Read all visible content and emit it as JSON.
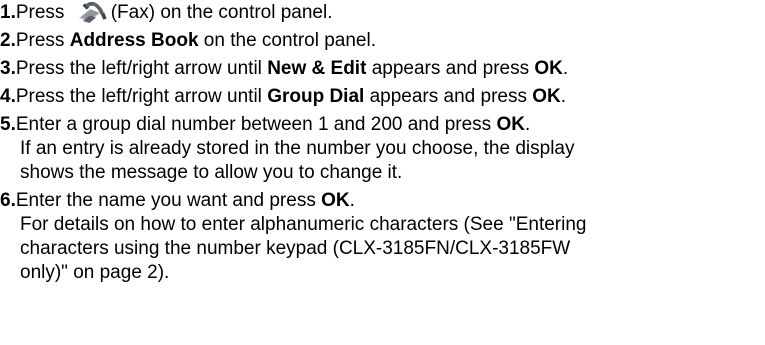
{
  "steps": [
    {
      "num": "1.",
      "pre": "Press ",
      "icon": "fax-icon",
      "post": "(Fax) on the control panel."
    },
    {
      "num": "2.",
      "pre": "Press ",
      "bold1": "Address Book",
      "post": " on the control panel."
    },
    {
      "num": "3.",
      "pre": "Press the left/right arrow until ",
      "bold1": "New & Edit",
      "mid": " appears and press ",
      "bold2": "OK",
      "post": "."
    },
    {
      "num": "4.",
      "pre": "Press the left/right arrow until ",
      "bold1": "Group Dial",
      "mid": " appears and press ",
      "bold2": "OK",
      "post": "."
    },
    {
      "num": "5.",
      "pre": "Enter a group dial number between 1 and 200 and press ",
      "bold1": "OK",
      "post": ".",
      "note_lines": [
        "If an entry is already stored in the number you choose, the display",
        "shows the message to allow you to change it."
      ]
    },
    {
      "num": "6.",
      "pre": "Enter the name you want and press ",
      "bold1": "OK",
      "post": ".",
      "note_lines": [
        "For details on how to enter alphanumeric characters (See \"Entering",
        "characters using the number keypad (CLX-3185FN/CLX-3185FW",
        "only)\" on page 2)."
      ]
    }
  ],
  "colors": {
    "text": "#000000",
    "background": "#ffffff",
    "icon_fill": "#5a6066",
    "icon_shadow": "#b8bec4"
  }
}
